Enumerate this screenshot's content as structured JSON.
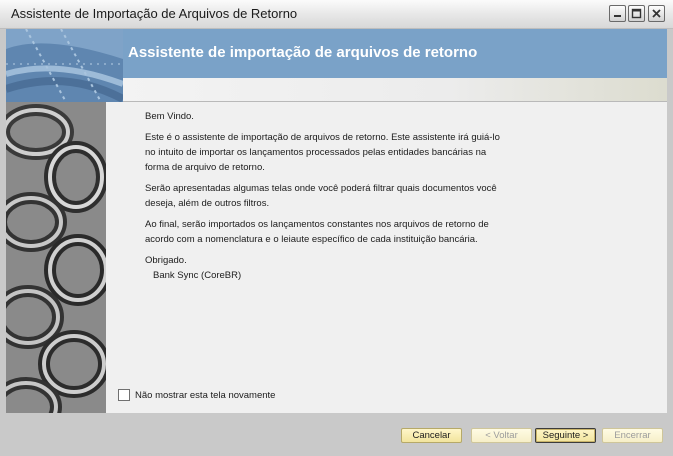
{
  "window": {
    "title": "Assistente de Importação de Arquivos de Retorno",
    "controls": [
      "minimize-icon",
      "maximize-icon",
      "close-icon"
    ]
  },
  "banner": {
    "title": "Assistente de importação de arquivos de retorno"
  },
  "body": {
    "greeting": "Bem Vindo.",
    "paragraphs": [
      "Este é o assistente de importação de arquivos de retorno. Este assistente irá guiá-lo no intuito de importar os lançamentos processados pelas entidades bancárias na forma de arquivo de retorno.",
      "Serão apresentadas algumas telas onde você poderá filtrar quais documentos você deseja, além de outros filtros.",
      "Ao final, serão importados os lançamentos constantes nos arquivos de retorno de acordo com a nomenclatura e o leiaute específico de cada instituição bancária."
    ],
    "closing": "Obrigado.",
    "signature": "Bank Sync (CoreBR)"
  },
  "checkbox": {
    "label": "Não mostrar esta tela novamente",
    "checked": false
  },
  "buttons": {
    "cancel": "Cancelar",
    "back": "< Voltar",
    "next": "Seguinte >",
    "finish": "Encerrar"
  },
  "colors": {
    "banner": "#7aa2c8",
    "button_face": "#f2e49d",
    "window_frame": "#c9c9c9"
  }
}
